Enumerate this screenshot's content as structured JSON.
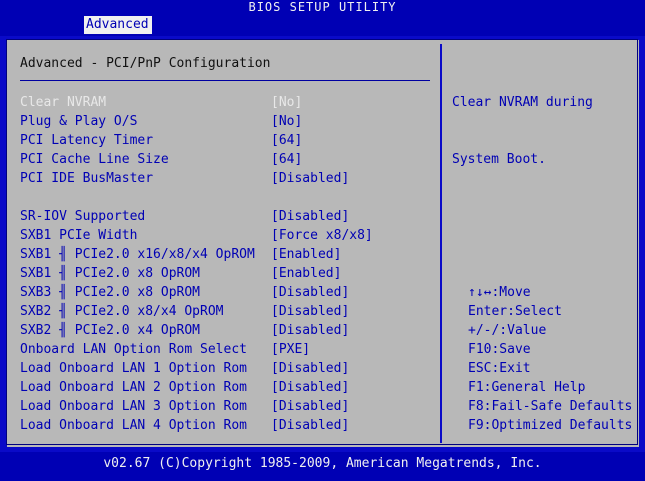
{
  "header": {
    "title": "BIOS SETUP UTILITY",
    "tab": "Advanced"
  },
  "section_title": "Advanced - PCI/PnP Configuration",
  "rows": [
    {
      "label": "Clear NVRAM",
      "value": "[No]"
    },
    {
      "label": "Plug & Play O/S",
      "value": "[No]"
    },
    {
      "label": "PCI Latency Timer",
      "value": "[64]"
    },
    {
      "label": "PCI Cache Line Size",
      "value": "[64]"
    },
    {
      "label": "PCI IDE BusMaster",
      "value": "[Disabled]"
    },
    {
      "label": "SR-IOV Supported",
      "value": "[Disabled]"
    },
    {
      "label": "SXB1 PCIe Width",
      "value": "[Force x8/x8]"
    },
    {
      "label": "SXB1 ╢ PCIe2.0 x16/x8/x4 OpROM",
      "value": "[Enabled]"
    },
    {
      "label": "SXB1 ╢ PCIe2.0 x8 OpROM",
      "value": "[Enabled]"
    },
    {
      "label": "SXB3 ╢ PCIe2.0 x8 OpROM",
      "value": "[Disabled]"
    },
    {
      "label": "SXB2 ╢ PCIe2.0 x8/x4 OpROM",
      "value": "[Disabled]"
    },
    {
      "label": "SXB2 ╢ PCIe2.0 x4 OpROM",
      "value": "[Disabled]"
    },
    {
      "label": "Onboard LAN Option Rom Select",
      "value": "[PXE]"
    },
    {
      "label": "Load Onboard LAN 1 Option Rom",
      "value": "[Disabled]"
    },
    {
      "label": "Load Onboard LAN 2 Option Rom",
      "value": "[Disabled]"
    },
    {
      "label": "Load Onboard LAN 3 Option Rom",
      "value": "[Disabled]"
    },
    {
      "label": "Load Onboard LAN 4 Option Rom",
      "value": "[Disabled]"
    }
  ],
  "help": {
    "line1": "Clear NVRAM during",
    "line2": "System Boot."
  },
  "keys": [
    "↑↓↔:Move",
    "Enter:Select",
    "+/-/:Value",
    "F10:Save",
    "ESC:Exit",
    "F1:General Help",
    "F8:Fail-Safe Defaults",
    "F9:Optimized Defaults"
  ],
  "footer": "v02.67 (C)Copyright 1985-2009, American Megatrends, Inc."
}
